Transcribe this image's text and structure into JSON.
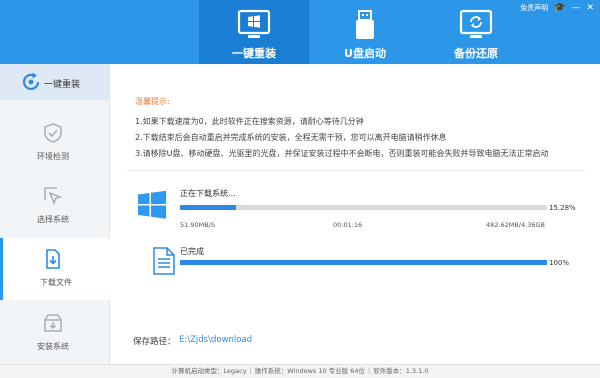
{
  "header": {
    "nav": [
      {
        "label": "一键重装",
        "icon": "windows-install-icon"
      },
      {
        "label": "U盘启动",
        "icon": "usb-drive-icon"
      },
      {
        "label": "备份还原",
        "icon": "backup-restore-icon"
      }
    ],
    "disclaimer": "免责声明",
    "window_controls": {
      "minimize": "—",
      "close": "✕"
    }
  },
  "sidebar": {
    "top_item": {
      "label": "一键重装",
      "icon": "refresh-icon"
    },
    "steps": [
      {
        "label": "环境检测",
        "icon": "shield-icon"
      },
      {
        "label": "选择系统",
        "icon": "cursor-icon"
      },
      {
        "label": "下载文件",
        "icon": "download-file-icon"
      },
      {
        "label": "安装系统",
        "icon": "install-box-icon"
      }
    ]
  },
  "tips": {
    "title": "温馨提示:",
    "lines": [
      "1.如果下载速度为0，此时软件正在搜索资源，请耐心等待几分钟",
      "2.下载结束后会自动重启并完成系统的安装，全程无需干预，您可以离开电脑请稍作休息",
      "3.请移除U盘、移动硬盘、光驱里的光盘，并保证安装过程中不会断电，否则重装可能会失败并导致电脑无法正常启动"
    ]
  },
  "download": {
    "title": "正在下载系统...",
    "percent_text": "15.28%",
    "progress": 0.1528,
    "speed": "51.90MB/S",
    "elapsed": "00:01:16",
    "size": "482.62MB/4.36GB"
  },
  "completed": {
    "title": "已完成",
    "percent_text": "100%",
    "progress": 1.0
  },
  "save_path": {
    "label": "保存路径：",
    "value": "E:\\Zjds\\download"
  },
  "footer": {
    "boot_label": "计算机启动类型：",
    "boot_value": "Legacy",
    "os_label": "操作系统：",
    "os_value": "Windows 10 专业版 64位",
    "version_label": "软件版本：",
    "version_value": "1.3.1.0"
  },
  "colors": {
    "header": "#2c97e8",
    "header_active": "#1a7fd4",
    "accent": "#2c8ae6",
    "tip_title": "#e6813a"
  }
}
